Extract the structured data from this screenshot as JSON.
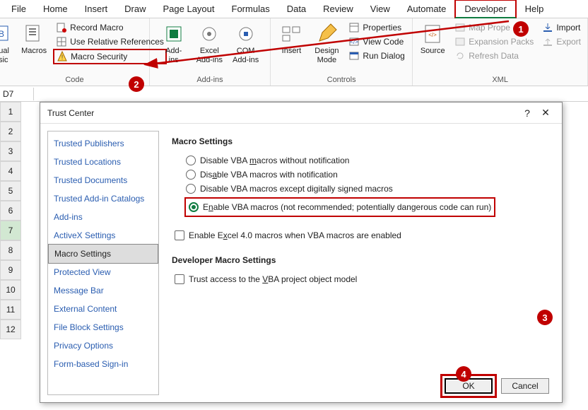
{
  "tabs": [
    "File",
    "Home",
    "Insert",
    "Draw",
    "Page Layout",
    "Formulas",
    "Data",
    "Review",
    "View",
    "Automate",
    "Developer",
    "Help"
  ],
  "active_tab_index": 10,
  "ribbon": {
    "code": {
      "visual_basic": "Visual\nBasic",
      "macros": "Macros",
      "record_macro": "Record Macro",
      "use_relative": "Use Relative References",
      "macro_security": "Macro Security",
      "group_label": "Code"
    },
    "addins": {
      "addins": "Add-\nins",
      "excel_addins": "Excel\nAdd-ins",
      "com_addins": "COM\nAdd-ins",
      "group_label": "Add-ins"
    },
    "controls": {
      "insert": "Insert",
      "design_mode": "Design\nMode",
      "properties": "Properties",
      "view_code": "View Code",
      "run_dialog": "Run Dialog",
      "group_label": "Controls"
    },
    "xml": {
      "source": "Source",
      "map_properties": "Map Prope",
      "expansion_packs": "Expansion Packs",
      "refresh_data": "Refresh Data",
      "import": "Import",
      "export": "Export",
      "group_label": "XML"
    }
  },
  "name_box": "D7",
  "row_headers": [
    "1",
    "2",
    "3",
    "4",
    "5",
    "6",
    "7",
    "8",
    "9",
    "10",
    "11",
    "12"
  ],
  "selected_row": 7,
  "dialog": {
    "title": "Trust Center",
    "nav": [
      "Trusted Publishers",
      "Trusted Locations",
      "Trusted Documents",
      "Trusted Add-in Catalogs",
      "Add-ins",
      "ActiveX Settings",
      "Macro Settings",
      "Protected View",
      "Message Bar",
      "External Content",
      "File Block Settings",
      "Privacy Options",
      "Form-based Sign-in"
    ],
    "selected_nav_index": 6,
    "section1": "Macro Settings",
    "radios": [
      "Disable VBA macros without notification",
      "Disable VBA macros with notification",
      "Disable VBA macros except digitally signed macros",
      "Enable VBA macros (not recommended; potentially dangerous code can run)"
    ],
    "selected_radio_index": 3,
    "check1": "Enable Excel 4.0 macros when VBA macros are enabled",
    "section2": "Developer Macro Settings",
    "check2": "Trust access to the VBA project object model",
    "ok": "OK",
    "cancel": "Cancel"
  },
  "badges": {
    "b1": "1",
    "b2": "2",
    "b3": "3",
    "b4": "4"
  }
}
